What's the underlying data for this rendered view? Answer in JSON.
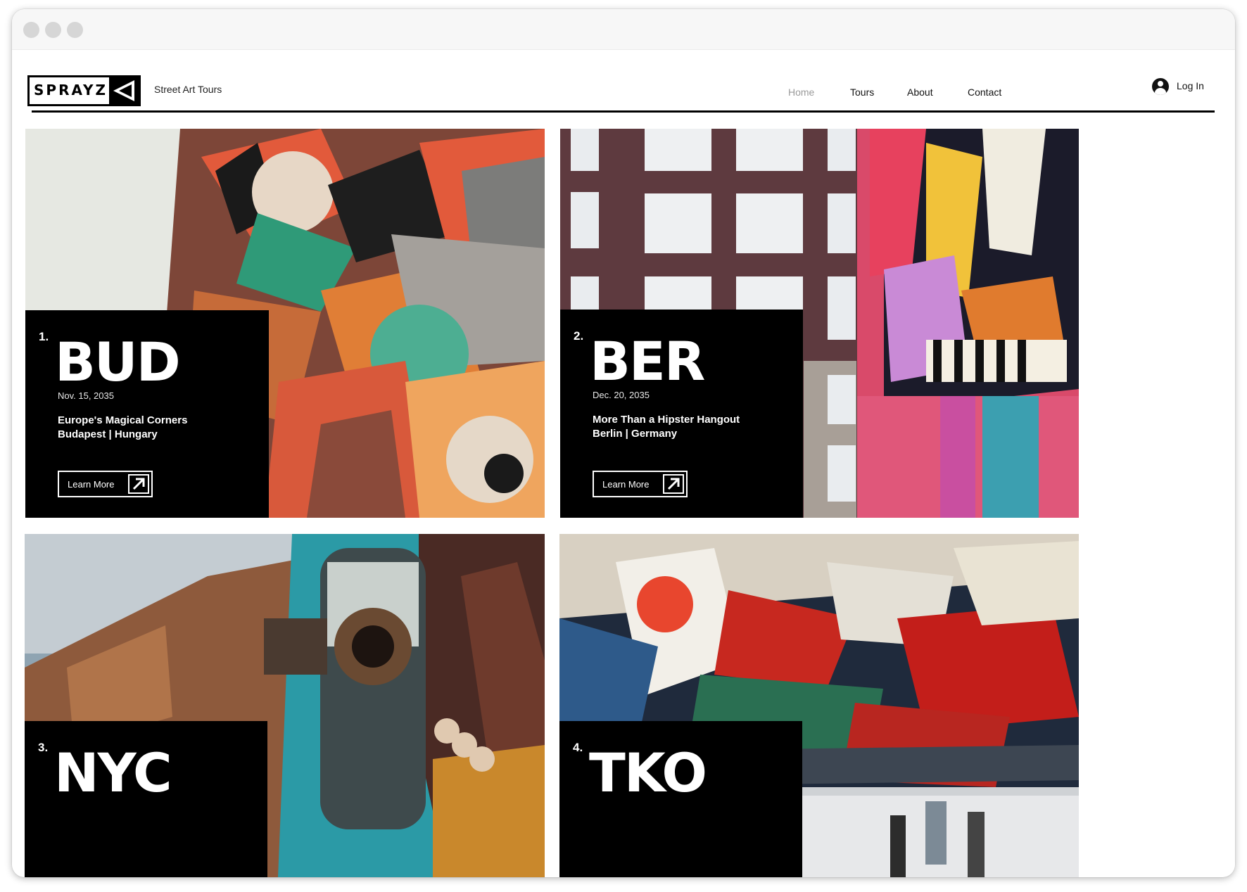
{
  "header": {
    "logo_text": "SPRAYZ",
    "tagline": "Street Art Tours",
    "nav": [
      {
        "label": "Home",
        "active": true
      },
      {
        "label": "Tours",
        "active": false
      },
      {
        "label": "About",
        "active": false
      },
      {
        "label": "Contact",
        "active": false
      }
    ],
    "login_label": "Log In"
  },
  "tours": [
    {
      "number": "1.",
      "code": "BUD",
      "date": "Nov. 15, 2035",
      "subtitle_line1": "Europe's Magical Corners",
      "subtitle_line2": "Budapest | Hungary",
      "cta": "Learn More"
    },
    {
      "number": "2.",
      "code": "BER",
      "date": "Dec. 20, 2035",
      "subtitle_line1": "More Than a Hipster Hangout",
      "subtitle_line2": "Berlin | Germany",
      "cta": "Learn More"
    },
    {
      "number": "3.",
      "code": "NYC"
    },
    {
      "number": "4.",
      "code": "TKO"
    }
  ],
  "colors": {
    "ink": "#000000",
    "nav_active": "#9a9a9a",
    "background": "#ffffff"
  },
  "icons": {
    "logo_mark": "triangle-flag-icon",
    "login": "user-avatar-icon",
    "cta": "arrow-up-right-icon"
  }
}
